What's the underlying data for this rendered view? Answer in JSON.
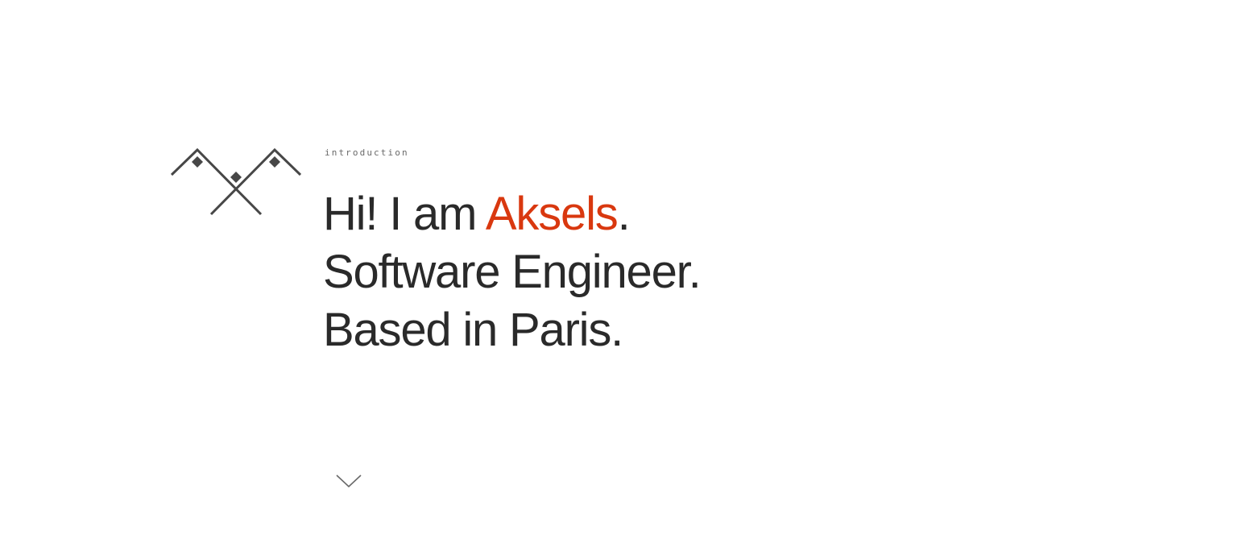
{
  "intro": {
    "label": "introduction"
  },
  "headline": {
    "greeting_prefix": "Hi! I am ",
    "name": "Aksels",
    "greeting_suffix": ".",
    "line2": "Software Engineer.",
    "line3": "Based in Paris."
  },
  "colors": {
    "accent": "#d9380f",
    "text": "#2a2a2a",
    "logo": "#474747"
  },
  "icons": {
    "logo": "mountain-flags-logo-icon",
    "scroll": "chevron-down-icon"
  }
}
